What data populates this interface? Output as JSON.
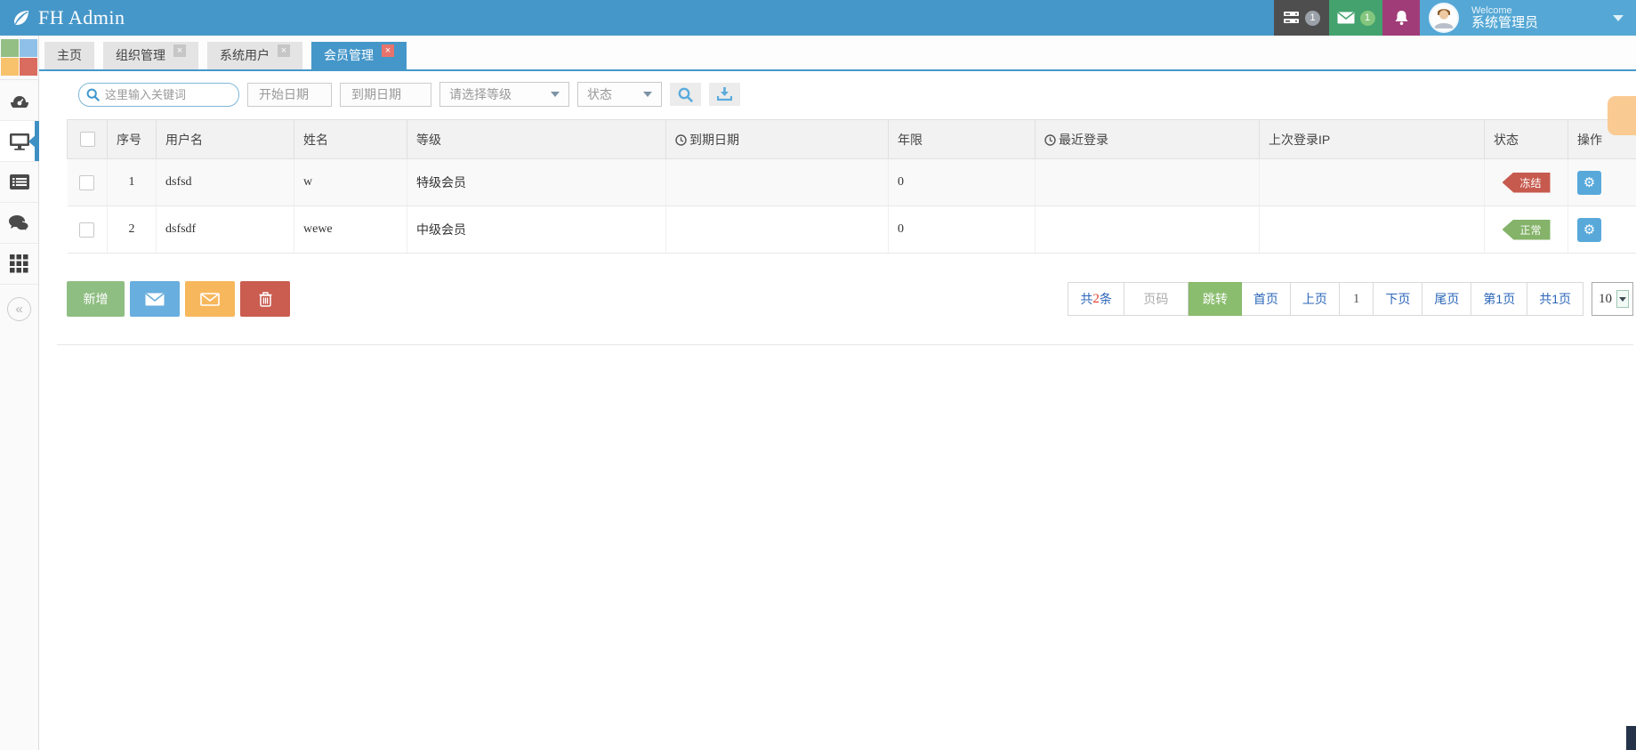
{
  "header": {
    "brand": "FH Admin",
    "welcome_small": "Welcome",
    "username": "系统管理员",
    "badges": {
      "tasks": "1",
      "messages": "1"
    }
  },
  "icons": {
    "close": "×",
    "collapse": "«",
    "gear": "⚙"
  },
  "colors": {
    "accent": "#4697c9",
    "badge_freeze": "#c75a4e",
    "badge_normal": "#84b369",
    "gear_blue": "#58a9da",
    "btn_add": "#8fbe82",
    "btn_mail_blue": "#68aede",
    "btn_mail_orange": "#f7b75c",
    "btn_trash": "#ca5c50",
    "jump_green": "#8bbd6f"
  },
  "tabs": [
    {
      "label": "主页",
      "closable": false,
      "active": false
    },
    {
      "label": "组织管理",
      "closable": true,
      "active": false
    },
    {
      "label": "系统用户",
      "closable": true,
      "active": false
    },
    {
      "label": "会员管理",
      "closable": true,
      "active": true
    }
  ],
  "toolbar": {
    "keyword_placeholder": "这里输入关键词",
    "start_date_placeholder": "开始日期",
    "end_date_placeholder": "到期日期",
    "level_select_value": "请选择等级",
    "status_select_value": "状态"
  },
  "table": {
    "columns": [
      "序号",
      "用户名",
      "姓名",
      "等级",
      "到期日期",
      "年限",
      "最近登录",
      "上次登录IP",
      "状态",
      "操作"
    ],
    "rows": [
      {
        "index": "1",
        "username": "dsfsd",
        "name": "w",
        "level": "特级会员",
        "expire_date": "",
        "years": "0",
        "last_login": "",
        "last_ip": "",
        "status": "冻结",
        "status_color": "#c75a4e"
      },
      {
        "index": "2",
        "username": "dsfsdf",
        "name": "wewe",
        "level": "中级会员",
        "expire_date": "",
        "years": "0",
        "last_login": "",
        "last_ip": "",
        "status": "正常",
        "status_color": "#84b369"
      }
    ]
  },
  "actions": {
    "add_label": "新增"
  },
  "pagination": {
    "total_prefix": "共",
    "total_count": "2",
    "total_suffix": "条",
    "page_input_placeholder": "页码",
    "jump_label": "跳转",
    "first": "首页",
    "prev": "上页",
    "current": "1",
    "next": "下页",
    "last": "尾页",
    "page_info": "第1页",
    "total_pages": "共1页",
    "page_size": "10"
  }
}
